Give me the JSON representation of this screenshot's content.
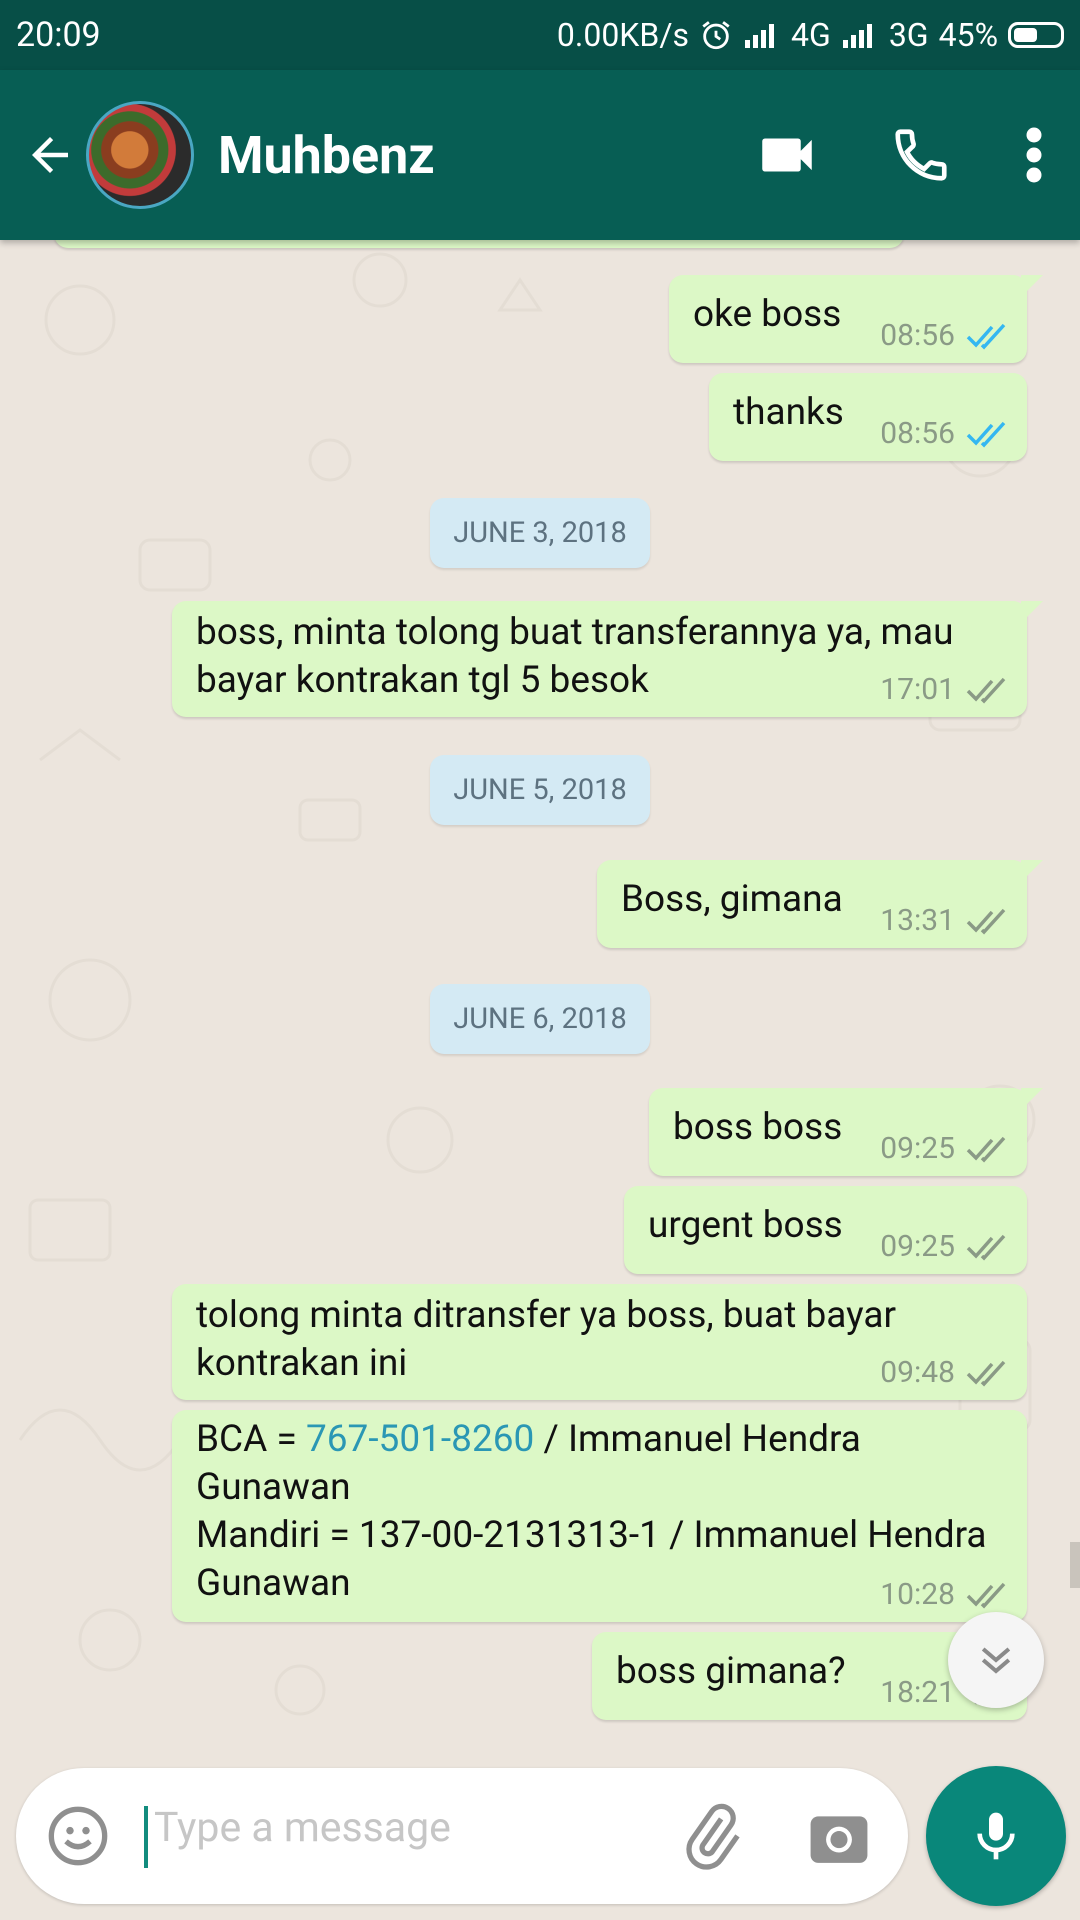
{
  "status_bar": {
    "time": "20:09",
    "net_speed": "0.00KB/s",
    "net1": "4G",
    "net2": "3G",
    "battery": "45%",
    "icons": [
      "alarm-icon",
      "signal-icon",
      "signal-icon",
      "battery-icon"
    ]
  },
  "header": {
    "contact_name": "Muhbenz",
    "icons": [
      "back-arrow-icon",
      "avatar",
      "video-call-icon",
      "phone-icon",
      "more-vert-icon"
    ]
  },
  "messages": [
    {
      "text": "oke boss",
      "time": "08:56",
      "status": "read"
    },
    {
      "text": "thanks",
      "time": "08:56",
      "status": "read"
    },
    {
      "date": "JUNE 3, 2018"
    },
    {
      "line1": "boss, minta tolong buat transferannya ya, mau",
      "line2": "bayar kontrakan tgl 5 besok",
      "time": "17:01",
      "status": "delivered"
    },
    {
      "date": "JUNE 5, 2018"
    },
    {
      "text": "Boss, gimana",
      "time": "13:31",
      "status": "delivered"
    },
    {
      "date": "JUNE 6, 2018"
    },
    {
      "text": "boss boss",
      "time": "09:25",
      "status": "delivered"
    },
    {
      "text": "urgent boss",
      "time": "09:25",
      "status": "delivered"
    },
    {
      "line1": "tolong minta ditransfer ya boss, buat bayar",
      "line2": "kontrakan ini",
      "time": "09:48",
      "status": "delivered"
    },
    {
      "bca_prefix": "BCA = ",
      "bca_number": "767-501-8260",
      "bca_suffix": " / Immanuel Hendra",
      "line2": "Gunawan",
      "line3": "Mandiri = 137-00-2131313-1 / Immanuel Hendra",
      "line4": "Gunawan",
      "time": "10:28",
      "status": "delivered"
    },
    {
      "text": "boss gimana?",
      "time": "18:21",
      "status": "delivered"
    }
  ],
  "composer": {
    "placeholder": "Type a message",
    "icons": [
      "emoji-icon",
      "attach-icon",
      "camera-icon",
      "mic-icon"
    ]
  },
  "colors": {
    "status_bar": "#074f47",
    "app_bar": "#075e54",
    "outgoing_bubble": "#dcf8c6",
    "date_chip": "#d4eaf4",
    "read_tick": "#34b7f1",
    "mic_button": "#09877a",
    "link": "#2a97b4"
  }
}
